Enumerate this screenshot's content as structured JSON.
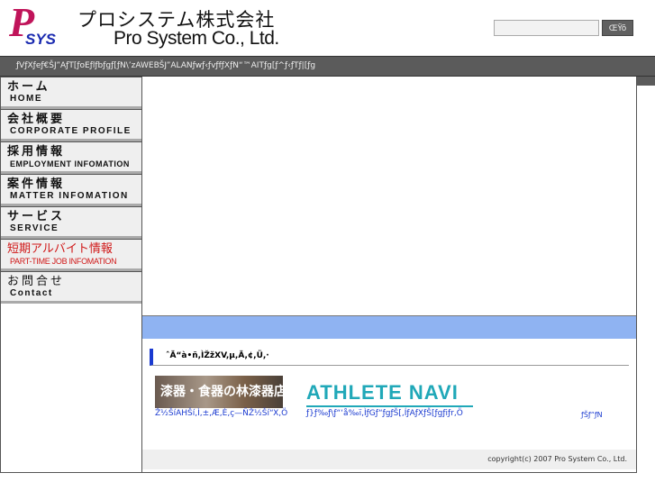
{
  "header": {
    "logo_text": "PSYS",
    "company_jp": "プロシステム株式会社",
    "company_en": "Pro System Co., Ltd.",
    "search_placeholder": "",
    "search_button": "ŒŸõ"
  },
  "topbar": {
    "text": "ƒVƒXƒeƒ€ŠJ”­AƒT[ƒoEƒlƒbƒgƒ[ƒN\\’zAWEBŠJ”­ALANƒwƒ‹ƒvƒfƒXƒN“™AITƒg[ƒ^ƒ‹ƒTƒ|[ƒg"
  },
  "nav": {
    "items": [
      {
        "jp": "ホーム",
        "en": "Home"
      },
      {
        "jp": "会社概要",
        "en": "Corporate Profile"
      },
      {
        "jp": "採用情報",
        "en": "Employment Infomation"
      },
      {
        "jp": "案件情報",
        "en": "Matter Infomation"
      },
      {
        "jp": "サービス",
        "en": "Service"
      },
      {
        "jp": "短期アルバイト情報",
        "en": "Part-time Job Infomation"
      },
      {
        "jp": "お問合せ",
        "en": "Contact"
      }
    ]
  },
  "main": {
    "section_title": "ˆÄ“à•ñ,ÌŽžXV,µ,Ä,¢,Ü,·",
    "banners": [
      {
        "image_text": "漆器・食器の林漆器店",
        "caption": "Ž½ŠíAHŠí,Ì,±,Æ,È,ç—ÑŽ½Ší“X,Ö"
      },
      {
        "image_text": "ATHLETE NAVI",
        "caption": "ƒ}ƒ‰ƒ\\ƒ“‘å‰ï,ÌƒGƒ“ƒgƒŠ[,ÍƒAƒXƒŠ[ƒgƒiƒr,Ö"
      }
    ],
    "more_link": "ƒŠƒ“ƒN",
    "copyright": "copyright(c) 2007 Pro System Co., Ltd."
  }
}
